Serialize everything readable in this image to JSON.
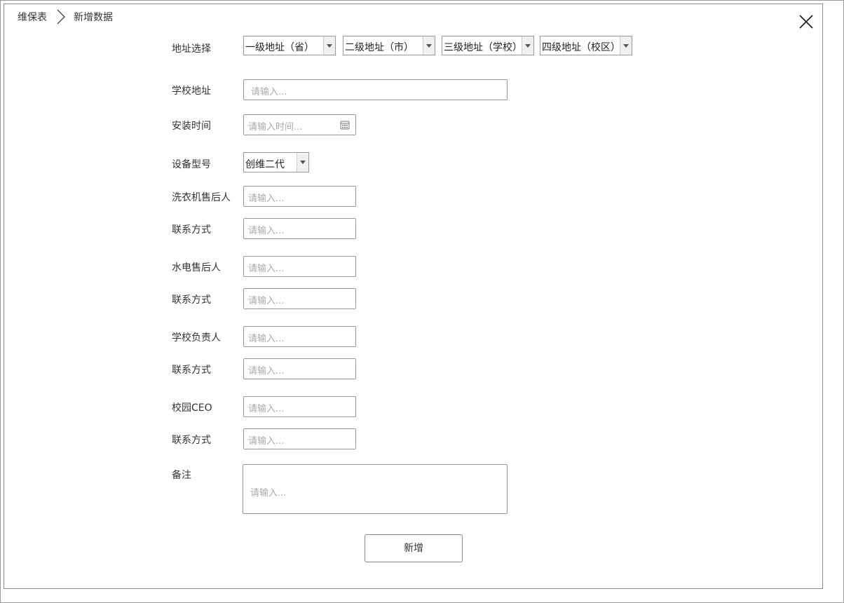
{
  "breadcrumb": {
    "parent": "维保表",
    "current": "新增数据"
  },
  "form": {
    "address": {
      "label": "地址选择",
      "province": "一级地址（省）",
      "city": "二级地址（市）",
      "school": "三级地址（学校）",
      "campus": "四级地址（校区）"
    },
    "school_address": {
      "label": "学校地址",
      "placeholder": "请输入..."
    },
    "install_time": {
      "label": "安装时间",
      "placeholder": "请输入时间..."
    },
    "device_model": {
      "label": "设备型号",
      "value": "创维二代"
    },
    "washer_aftersale": {
      "label": "洗衣机售后人",
      "placeholder": "请输入..."
    },
    "washer_contact": {
      "label": "联系方式",
      "placeholder": "请输入..."
    },
    "utility_aftersale": {
      "label": "水电售后人",
      "placeholder": "请输入..."
    },
    "utility_contact": {
      "label": "联系方式",
      "placeholder": "请输入..."
    },
    "school_manager": {
      "label": "学校负责人",
      "placeholder": "请输入..."
    },
    "manager_contact": {
      "label": "联系方式",
      "placeholder": "请输入..."
    },
    "campus_ceo": {
      "label": "校园CEO",
      "placeholder": "请输入..."
    },
    "ceo_contact": {
      "label": "联系方式",
      "placeholder": "请输入..."
    },
    "remarks": {
      "label": "备注",
      "placeholder": "请输入..."
    }
  },
  "submit_label": "新增",
  "icons": {
    "close": "close-icon",
    "breadcrumb_sep": "chevron-right-icon",
    "calendar": "calendar-icon",
    "dropdown": "chevron-down-icon"
  }
}
